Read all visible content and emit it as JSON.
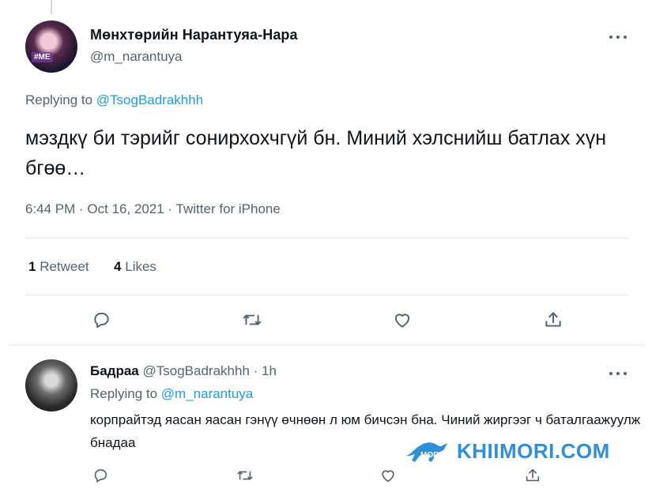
{
  "main_tweet": {
    "display_name": "Мөнхтөрийн Нарантуяа-Нара",
    "handle": "@m_narantuya",
    "avatar_tag": "#ME",
    "replying_label": "Replying to ",
    "replying_to": "@TsogBadrakhhh",
    "text": "мэздкү би тэрийг сонирхохчгүй бн. Миний хэлснийш батлах хүн бгөө…",
    "timestamp": "6:44 PM · Oct 16, 2021 · Twitter for iPhone",
    "retweets_count": "1",
    "retweets_label": "Retweet",
    "likes_count": "4",
    "likes_label": "Likes"
  },
  "reply_tweet": {
    "display_name": "Бадраа",
    "handle": "@TsogBadrakhhh",
    "time": "· 1h",
    "replying_label": "Replying to ",
    "replying_to": "@m_narantuya",
    "text": "корпрайтэд яасан яасан гэнүү өчнөөн л юм бичсэн бна. Чиний жиргээг ч баталгаажуулж бнадаа"
  },
  "watermark": {
    "text": "KHIIMORI.COM",
    "logo_text": "MORI"
  },
  "icons": [
    "more-icon",
    "reply-icon",
    "retweet-icon",
    "like-icon",
    "share-icon"
  ],
  "colors": {
    "link": "#1d9bf0",
    "secondary_text": "#536471",
    "primary_text": "#0f1419",
    "watermark": "#2f8fd8"
  }
}
